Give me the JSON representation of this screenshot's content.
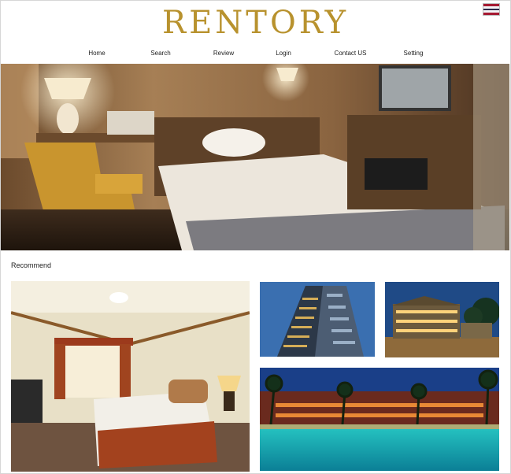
{
  "brand": {
    "logo_text": "RENTORY",
    "language_flag_icon": "thai-flag-icon"
  },
  "nav": {
    "items": [
      {
        "label": "Home"
      },
      {
        "label": "Search"
      },
      {
        "label": "Review"
      },
      {
        "label": "Login"
      },
      {
        "label": "Contact US"
      },
      {
        "label": "Setting"
      }
    ]
  },
  "hero": {
    "image": "hotel-room-photo"
  },
  "recommend": {
    "title": "Recommend",
    "cards": [
      {
        "image": "hotel-bedroom-photo"
      },
      {
        "image": "hotel-tower-photo"
      },
      {
        "image": "hotel-resort-photo"
      },
      {
        "image": "hotel-pool-photo"
      }
    ]
  },
  "colors": {
    "logo": "#b8922e",
    "nav_text": "#222222",
    "border": "#d6d6d6"
  }
}
